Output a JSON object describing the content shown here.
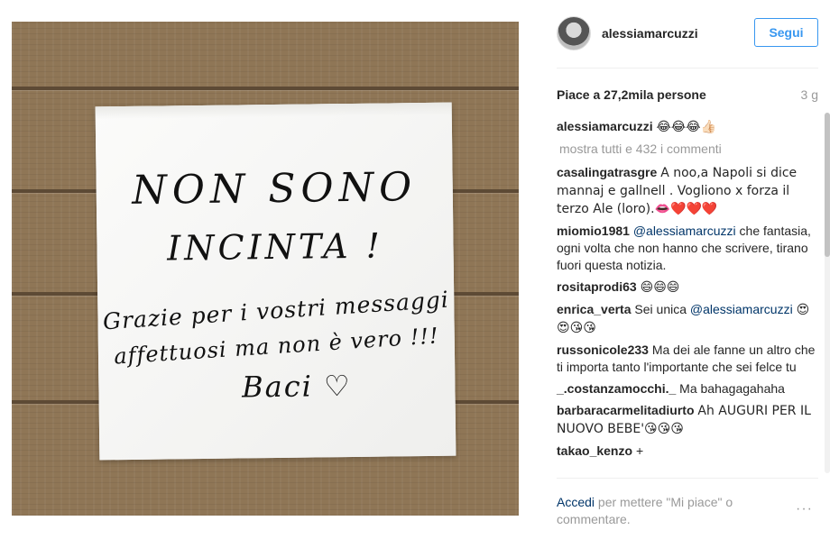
{
  "photo": {
    "napkin_lines": [
      "NON SONO",
      "INCINTA !",
      "Grazie per i vostri messaggi",
      "affettuosi ma non è vero !!!",
      "Baci ♡"
    ]
  },
  "header": {
    "username": "alessiamarcuzzi",
    "follow_label": "Segui"
  },
  "likes": {
    "text": "Piace a 27,2mila persone",
    "age": "3 g"
  },
  "caption": {
    "username": "alessiamarcuzzi",
    "text": "😂😂😂👍🏻"
  },
  "show_all": "mostra tutti e 432 i commenti",
  "comments": [
    {
      "user": "casalingatrasgre",
      "text": "A noo,a Napoli si dice mannaj e gallnell . Vogliono x forza il terzo Ale (loro).👄❤️❤️❤️"
    },
    {
      "user": "miomio1981",
      "mention": "@alessiamarcuzzi",
      "text": "che fantasia, ogni volta che non hanno che scrivere, tirano fuori questa notizia."
    },
    {
      "user": "rositaprodi63",
      "text": "😄😄😄"
    },
    {
      "user": "enrica_verta",
      "text": "Sei unica",
      "mention": "@alessiamarcuzzi",
      "text2": "😍😍😘😘"
    },
    {
      "user": "russonicole233",
      "text": "Ma dei ale fanne un altro che ti importa tanto l'importante che sei felce tu"
    },
    {
      "user": "_.costanzamocchi._",
      "text": "Ma bahagagahaha"
    },
    {
      "user": "barbaracarmelitadiurto",
      "text": "Ah AUGURI PER IL NUOVO BEBE'😘😘😘"
    },
    {
      "user": "takao_kenzo",
      "text": "+"
    }
  ],
  "footer": {
    "login_link": "Accedi",
    "text": "per mettere \"Mi piace\" o commentare."
  },
  "more_options": "···",
  "colors": {
    "accent": "#3897f0",
    "link": "#003569",
    "muted": "#999999"
  }
}
